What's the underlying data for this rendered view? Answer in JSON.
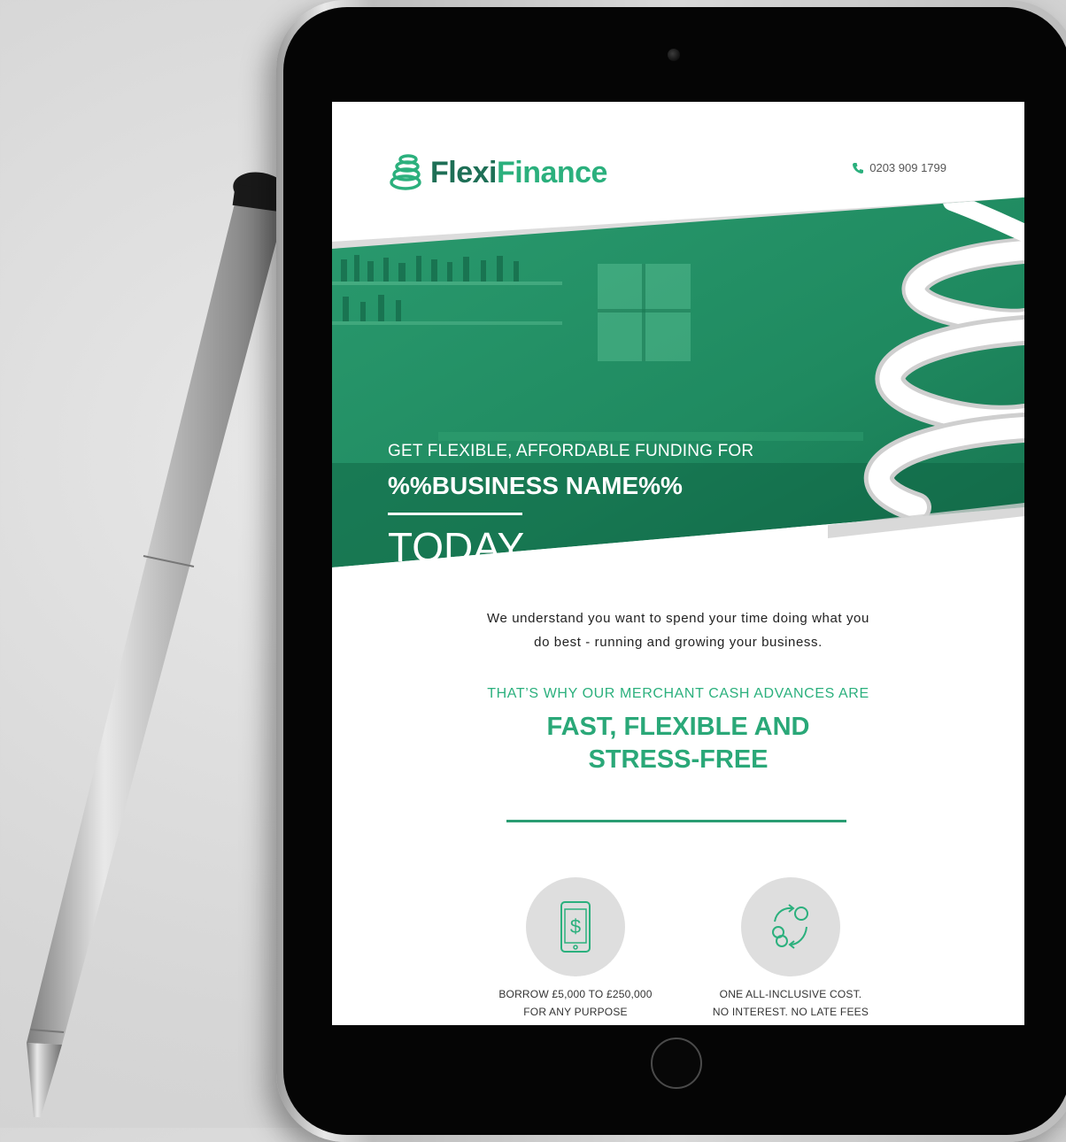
{
  "logo": {
    "part1": "Flexi",
    "part2": "Finance"
  },
  "header": {
    "phone_number": "0203 909 1799"
  },
  "hero": {
    "line1": "GET FLEXIBLE, AFFORDABLE FUNDING FOR",
    "line2": "%%BUSINESS NAME%%",
    "line3": "TODAY"
  },
  "intro": {
    "line1": "We understand you want to spend your time doing what you",
    "line2": "do best - running and growing your business."
  },
  "headline": {
    "subheading": "THAT’S WHY OUR MERCHANT CASH ADVANCES ARE",
    "line1": "FAST, FLEXIBLE AND",
    "line2": "STRESS-FREE"
  },
  "features": [
    {
      "icon": "mobile-dollar-icon",
      "line1": "BORROW £5,000 TO £250,000",
      "line2": "FOR ANY PURPOSE"
    },
    {
      "icon": "coins-cycle-icon",
      "line1": "ONE ALL-INCLUSIVE COST.",
      "line2": "NO INTEREST. NO LATE FEES"
    }
  ],
  "colors": {
    "brand_dark_green": "#1e6f56",
    "brand_green": "#2bb07d",
    "hero_overlay": "#1f9a6c",
    "background": "#d6d6d6",
    "tablet_bezel": "#050505"
  }
}
